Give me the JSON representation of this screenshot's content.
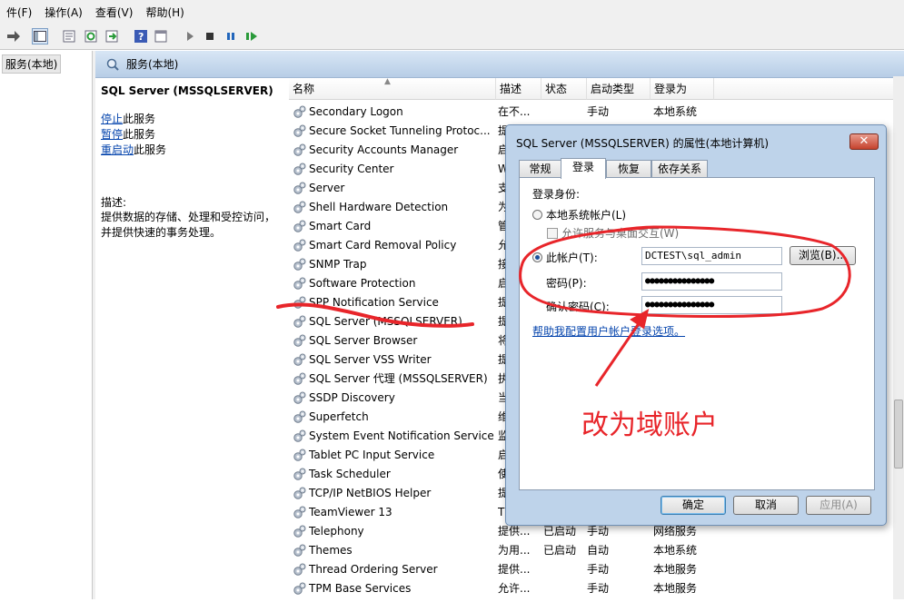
{
  "menu": [
    "件(F)",
    "操作(A)",
    "查看(V)",
    "帮助(H)"
  ],
  "tree": {
    "root": "服务(本地)"
  },
  "header": {
    "title": "服务(本地)"
  },
  "description": {
    "service": "SQL Server (MSSQLSERVER)",
    "actions": [
      {
        "link": "停止",
        "rest": "此服务"
      },
      {
        "link": "暂停",
        "rest": "此服务"
      },
      {
        "link": "重启动",
        "rest": "此服务"
      }
    ],
    "label": "描述:",
    "lines": [
      "提供数据的存储、处理和受控访问，",
      "并提供快速的事务处理。"
    ]
  },
  "columns": [
    "名称",
    "描述",
    "状态",
    "启动类型",
    "登录为"
  ],
  "rows": [
    {
      "name": "Secondary Logon",
      "desc": "在不...",
      "status": "",
      "startup": "手动",
      "logon": "本地系统"
    },
    {
      "name": "Secure Socket Tunneling Protoc...",
      "desc": "提",
      "status": "",
      "startup": "",
      "logon": ""
    },
    {
      "name": "Security Accounts Manager",
      "desc": "启",
      "status": "",
      "startup": "",
      "logon": ""
    },
    {
      "name": "Security Center",
      "desc": "W",
      "status": "",
      "startup": "",
      "logon": ""
    },
    {
      "name": "Server",
      "desc": "支",
      "status": "",
      "startup": "",
      "logon": ""
    },
    {
      "name": "Shell Hardware Detection",
      "desc": "为",
      "status": "",
      "startup": "",
      "logon": ""
    },
    {
      "name": "Smart Card",
      "desc": "管",
      "status": "",
      "startup": "",
      "logon": ""
    },
    {
      "name": "Smart Card Removal Policy",
      "desc": "允",
      "status": "",
      "startup": "",
      "logon": ""
    },
    {
      "name": "SNMP Trap",
      "desc": "接",
      "status": "",
      "startup": "",
      "logon": ""
    },
    {
      "name": "Software Protection",
      "desc": "启",
      "status": "",
      "startup": "",
      "logon": ""
    },
    {
      "name": "SPP Notification Service",
      "desc": "提",
      "status": "",
      "startup": "",
      "logon": ""
    },
    {
      "name": "SQL Server (MSSQLSERVER)",
      "desc": "提",
      "status": "",
      "startup": "",
      "logon": ""
    },
    {
      "name": "SQL Server Browser",
      "desc": "将",
      "status": "",
      "startup": "",
      "logon": ""
    },
    {
      "name": "SQL Server VSS Writer",
      "desc": "提",
      "status": "",
      "startup": "",
      "logon": ""
    },
    {
      "name": "SQL Server 代理 (MSSQLSERVER)",
      "desc": "执",
      "status": "",
      "startup": "",
      "logon": ""
    },
    {
      "name": "SSDP Discovery",
      "desc": "当",
      "status": "",
      "startup": "",
      "logon": ""
    },
    {
      "name": "Superfetch",
      "desc": "维",
      "status": "",
      "startup": "",
      "logon": ""
    },
    {
      "name": "System Event Notification Service",
      "desc": "监",
      "status": "",
      "startup": "",
      "logon": ""
    },
    {
      "name": "Tablet PC Input Service",
      "desc": "启",
      "status": "",
      "startup": "",
      "logon": ""
    },
    {
      "name": "Task Scheduler",
      "desc": "使",
      "status": "",
      "startup": "",
      "logon": ""
    },
    {
      "name": "TCP/IP NetBIOS Helper",
      "desc": "提",
      "status": "",
      "startup": "",
      "logon": ""
    },
    {
      "name": "TeamViewer 13",
      "desc": "T",
      "status": "",
      "startup": "",
      "logon": ""
    },
    {
      "name": "Telephony",
      "desc": "提供...",
      "status": "已启动",
      "startup": "手动",
      "logon": "网络服务"
    },
    {
      "name": "Themes",
      "desc": "为用...",
      "status": "已启动",
      "startup": "自动",
      "logon": "本地系统"
    },
    {
      "name": "Thread Ordering Server",
      "desc": "提供...",
      "status": "",
      "startup": "手动",
      "logon": "本地服务"
    },
    {
      "name": "TPM Base Services",
      "desc": "允许...",
      "status": "",
      "startup": "手动",
      "logon": "本地服务"
    }
  ],
  "dialog": {
    "title": "SQL Server (MSSQLSERVER) 的属性(本地计算机)",
    "close": "✕",
    "tabs": [
      "常规",
      "登录",
      "恢复",
      "依存关系"
    ],
    "logon_as": "登录身份:",
    "local_system": "本地系统帐户(L)",
    "interact": "允许服务与桌面交互(W)",
    "this_account": "此帐户(T):",
    "account_value": "DCTEST\\sql_admin",
    "browse": "浏览(B)...",
    "password_label": "密码(P):",
    "password_value": "●●●●●●●●●●●●●●●",
    "confirm_label": "确认密码(C):",
    "confirm_value": "●●●●●●●●●●●●●●●",
    "help_link": "帮助我配置用户帐户登录选项。",
    "ok": "确定",
    "cancel": "取消",
    "apply": "应用(A)"
  },
  "annotation": "改为域账户",
  "colors": {
    "annotation": "#e8252a",
    "link": "#0645ad",
    "header": "#c7d9ee"
  }
}
